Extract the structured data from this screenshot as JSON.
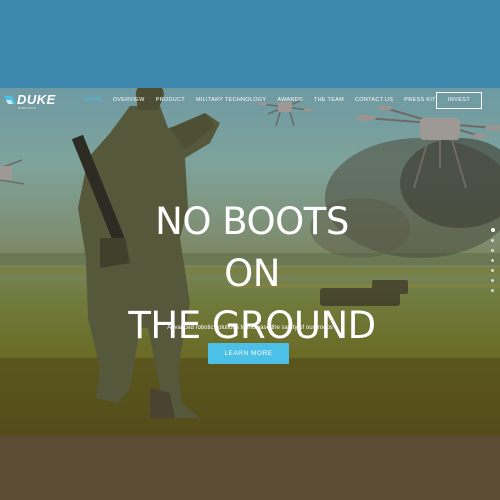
{
  "brand": {
    "name": "DUKE",
    "tagline": "ROBOTICS"
  },
  "nav": {
    "items": [
      {
        "label": "HOME",
        "active": true
      },
      {
        "label": "OVERVIEW",
        "active": false
      },
      {
        "label": "PRODUCT",
        "active": false
      },
      {
        "label": "MILITARY TECHNOLOGY",
        "active": false
      },
      {
        "label": "AWARDS",
        "active": false
      },
      {
        "label": "THE TEAM",
        "active": false
      },
      {
        "label": "CONTACT US",
        "active": false
      },
      {
        "label": "PRESS KIT",
        "active": false
      }
    ],
    "invest_label": "INVEST"
  },
  "hero": {
    "headline_line1": "NO BOOTS ON",
    "headline_line2": "THE GROUND",
    "subtext": "Advanced robotic solutions to increase the safety of our troops",
    "cta_label": "LEARN MORE",
    "slide_count": 7,
    "active_slide": 1
  },
  "colors": {
    "accent": "#4cc0e6",
    "active_nav": "#4ec3e8",
    "top_band": "#3d87ad",
    "bottom_band": "#5b4c34"
  }
}
